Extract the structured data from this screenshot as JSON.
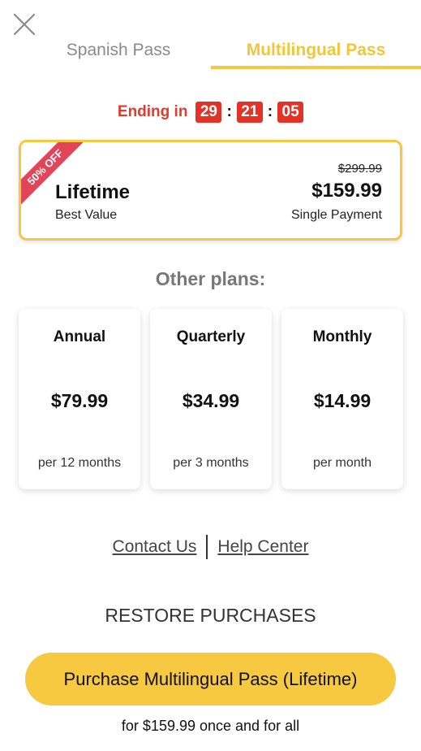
{
  "header": {
    "close_icon": "close-x-icon",
    "tabs": [
      {
        "label": "Spanish Pass",
        "active": false
      },
      {
        "label": "Multilingual Pass",
        "active": true
      }
    ],
    "accent_color": "#f5c842"
  },
  "countdown": {
    "label": "Ending in",
    "hours": "29",
    "minutes": "21",
    "seconds": "05",
    "separator": ":",
    "color": "#e53226"
  },
  "featured_plan": {
    "ribbon": "50% OFF",
    "title": "Lifetime",
    "subtitle": "Best Value",
    "original_price": "$299.99",
    "price": "$159.99",
    "note": "Single Payment",
    "ribbon_color": "#e04657"
  },
  "other_plans": {
    "heading": "Other plans:",
    "plans": [
      {
        "name": "Annual",
        "price": "$79.99",
        "period": "per 12 months"
      },
      {
        "name": "Quarterly",
        "price": "$34.99",
        "period": "per 3 months"
      },
      {
        "name": "Monthly",
        "price": "$14.99",
        "period": "per month"
      }
    ]
  },
  "links": {
    "contact": "Contact Us",
    "help": "Help Center"
  },
  "restore": {
    "label": "RESTORE PURCHASES"
  },
  "purchase": {
    "button_label": "Purchase Multilingual Pass (Lifetime)",
    "footnote": "for $159.99 once and for all",
    "button_color": "#f7c940"
  }
}
